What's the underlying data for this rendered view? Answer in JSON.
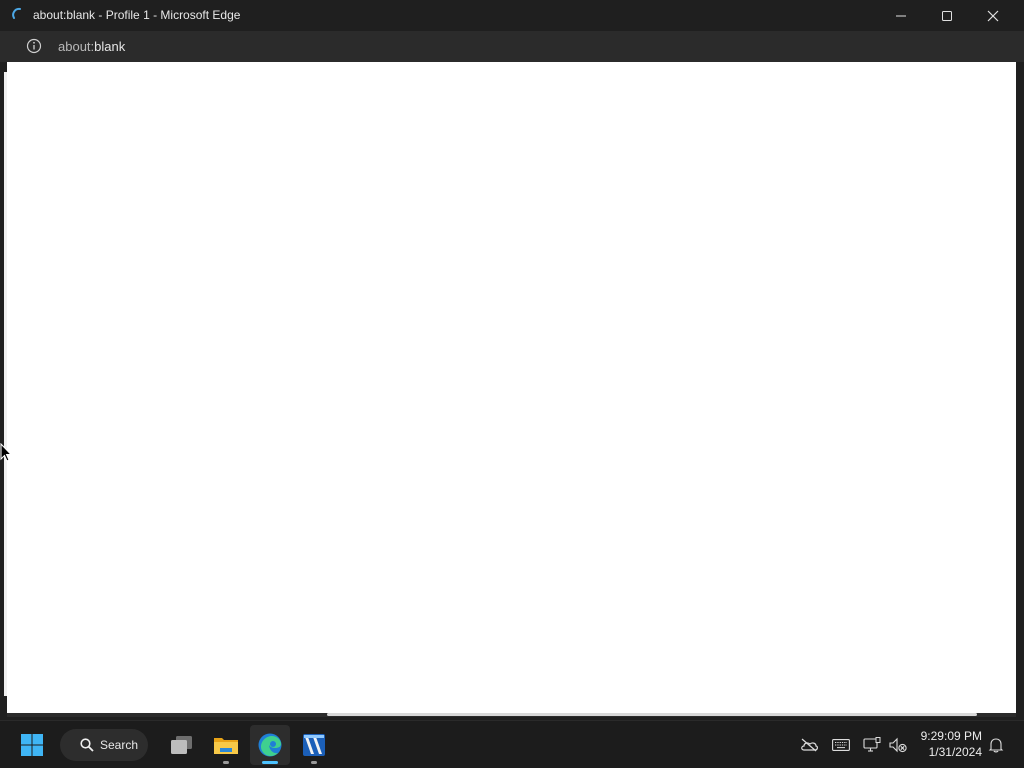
{
  "window": {
    "title": "about:blank - Profile 1 - Microsoft Edge",
    "url_prefix": "about:",
    "url_host": "blank"
  },
  "taskbar": {
    "search_label": "Search",
    "apps": [
      "start-icon",
      "search-icon",
      "task-view-icon",
      "file-explorer-icon",
      "edge-icon",
      "app-icon"
    ]
  },
  "tray": {
    "time": "9:29:09 PM",
    "date": "1/31/2024",
    "icons": [
      "onedrive-offline-icon",
      "keyboard-icon",
      "network-icon",
      "volume-muted-icon",
      "notification-bell-icon"
    ]
  },
  "colors": {
    "accent": "#4cc2ff",
    "titlebar": "#1f1f1f",
    "taskbar": "#1c1c1c"
  }
}
